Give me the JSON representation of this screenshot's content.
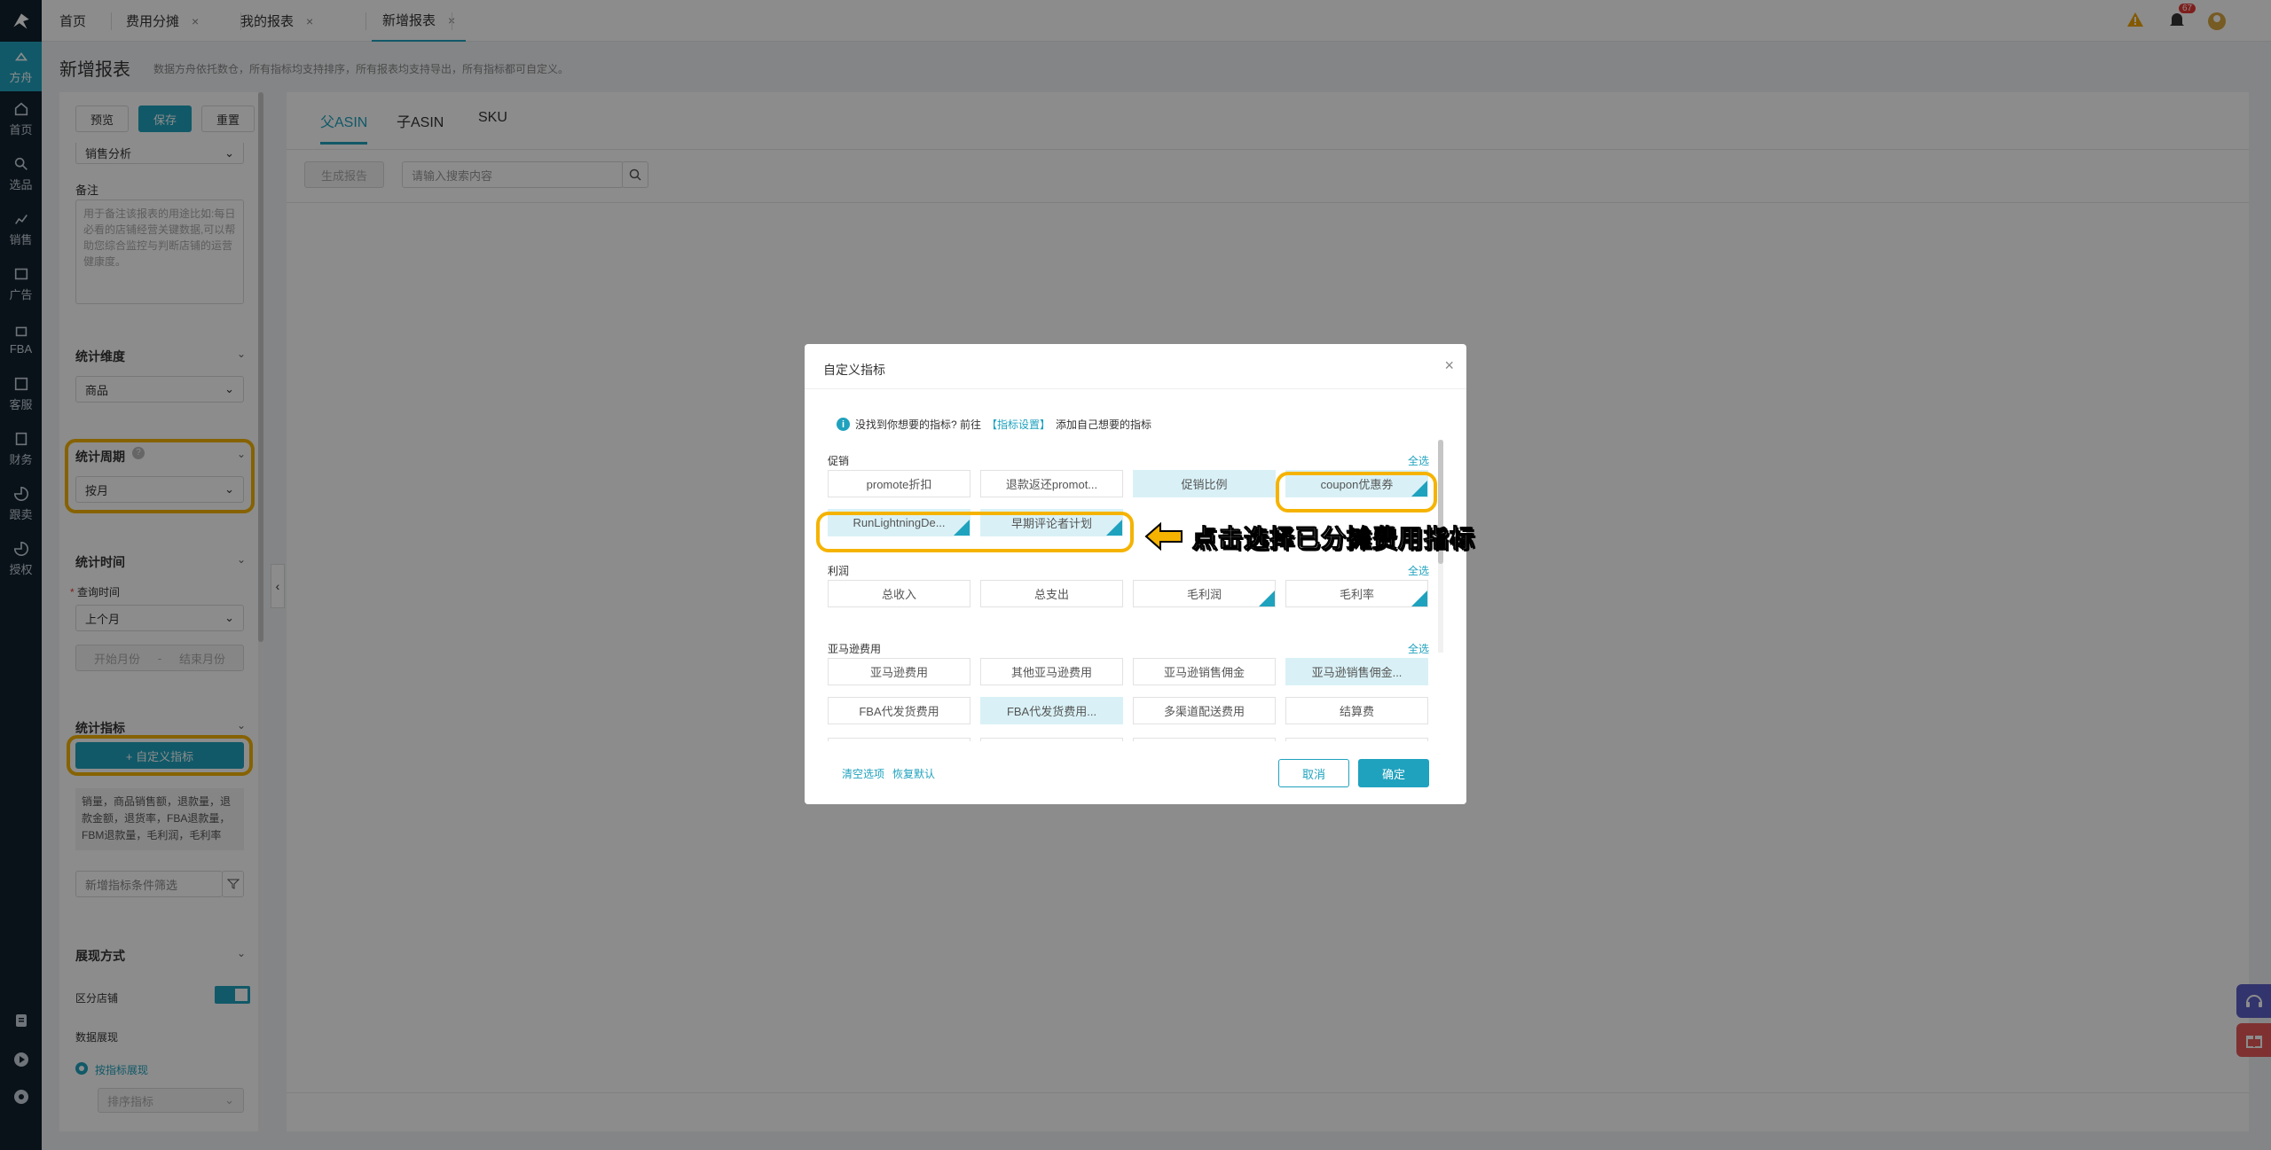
{
  "rail": {
    "logo": "logo-icon",
    "items": [
      {
        "label": "方舟",
        "icon": "ark-icon",
        "active": true
      },
      {
        "label": "首页",
        "icon": "home-icon"
      },
      {
        "label": "选品",
        "icon": "search-icon"
      },
      {
        "label": "销售",
        "icon": "chart-icon"
      },
      {
        "label": "广告",
        "icon": "ad-icon"
      },
      {
        "label": "FBA",
        "icon": "fba-icon"
      },
      {
        "label": "客服",
        "icon": "service-icon"
      },
      {
        "label": "财务",
        "icon": "finance-icon"
      },
      {
        "label": "跟卖",
        "icon": "pie-icon"
      },
      {
        "label": "授权",
        "icon": "auth-icon"
      }
    ]
  },
  "tabs": [
    {
      "label": "首页"
    },
    {
      "label": "费用分摊",
      "close": "×"
    },
    {
      "label": "我的报表",
      "close": "×"
    },
    {
      "label": "新增报表",
      "close": "×",
      "active": true
    }
  ],
  "topbar": {
    "notif_count": "67"
  },
  "page": {
    "title": "新增报表",
    "desc": "数据方舟依托数仓，所有指标均支持排序，所有报表均支持导出，所有指标都可自定义。"
  },
  "left": {
    "preview": "预览",
    "save": "保存",
    "reset": "重置",
    "analysis_type": "销售分析",
    "note_label": "备注",
    "note_placeholder": "用于备注该报表的用途比如:每日必看的店铺经营关键数据,可以帮助您综合监控与判断店铺的运营健康度。",
    "dimension": {
      "title": "统计维度",
      "value": "商品"
    },
    "period": {
      "title": "统计周期",
      "value": "按月"
    },
    "time": {
      "title": "统计时间",
      "query_label": "查询时间",
      "query_value": "上个月",
      "start": "开始月份",
      "sep": "-",
      "end": "结束月份"
    },
    "metrics": {
      "title": "统计指标",
      "custom_btn": "+ 自定义指标",
      "list": "销量，商品销售额，退款量，退款金额，退货率，FBA退款量，FBM退款量，毛利润，毛利率",
      "filter_placeholder": "新增指标条件筛选"
    },
    "display": {
      "title": "展现方式",
      "toggle_label": "区分店铺",
      "data_label": "数据展现",
      "radio": "按指标展现",
      "sort": "排序指标"
    }
  },
  "main": {
    "tabs": [
      "父ASIN",
      "子ASIN",
      "SKU"
    ],
    "gen_btn": "生成报告",
    "search_placeholder": "请输入搜索内容"
  },
  "dialog": {
    "title": "自定义指标",
    "close": "×",
    "info": "没找到你想要的指标? 前往",
    "info_link": "【指标设置】",
    "info_tail": "添加自己想要的指标",
    "select_all": "全选",
    "groups": [
      {
        "name": "促销",
        "rows": [
          [
            {
              "t": "promote折扣"
            },
            {
              "t": "退款返还promot..."
            },
            {
              "t": "促销比例",
              "s": true
            },
            {
              "t": "coupon优惠券",
              "s": true,
              "c": true
            }
          ],
          [
            {
              "t": "RunLightningDe...",
              "s": true,
              "c": true
            },
            {
              "t": "早期评论者计划",
              "s": true,
              "c": true
            }
          ]
        ]
      },
      {
        "name": "利润",
        "rows": [
          [
            {
              "t": "总收入"
            },
            {
              "t": "总支出"
            },
            {
              "t": "毛利润",
              "c": true
            },
            {
              "t": "毛利率",
              "c": true
            }
          ]
        ]
      },
      {
        "name": "亚马逊费用",
        "rows": [
          [
            {
              "t": "亚马逊费用"
            },
            {
              "t": "其他亚马逊费用"
            },
            {
              "t": "亚马逊销售佣金"
            },
            {
              "t": "亚马逊销售佣金...",
              "s": true
            }
          ],
          [
            {
              "t": "FBA代发货费用"
            },
            {
              "t": "FBA代发货费用...",
              "s": true
            },
            {
              "t": "多渠道配送费用"
            },
            {
              "t": "结算费"
            }
          ]
        ]
      }
    ],
    "clear": "清空选项",
    "restore": "恢复默认",
    "cancel": "取消",
    "ok": "确定"
  },
  "annotation": "点击选择已分摊费用指标",
  "colors": {
    "accent": "#1fa2be",
    "highlight": "#f5b300",
    "rail": "#12222f"
  }
}
